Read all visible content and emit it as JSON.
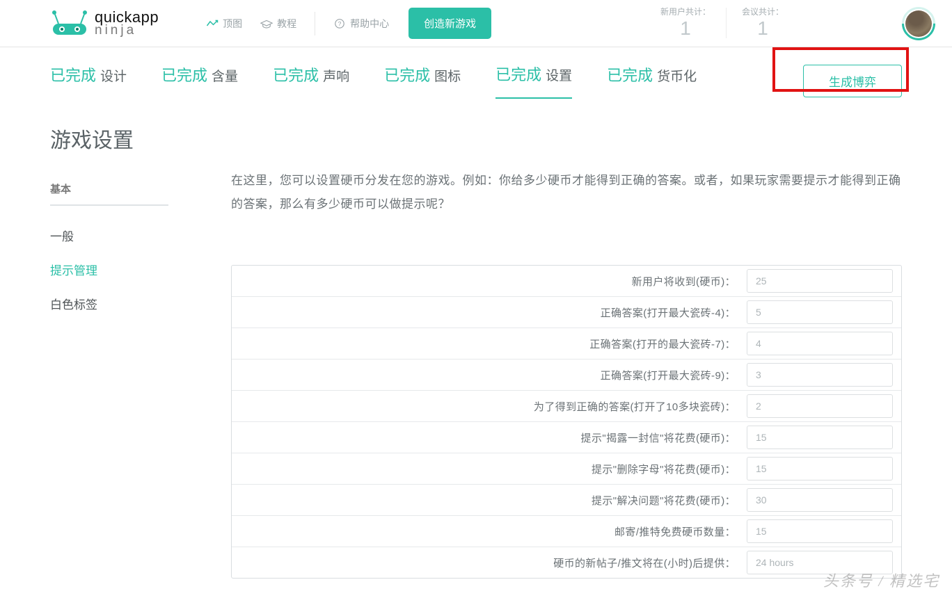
{
  "header": {
    "logo_line1": "quickapp",
    "logo_line2": "ninja",
    "nav": {
      "top": "顶图",
      "tutorial": "教程",
      "help": "帮助中心"
    },
    "create_button": "创造新游戏",
    "stats": {
      "new_users_label": "新用户共计：",
      "new_users_value": "1",
      "meetings_label": "会议共计：",
      "meetings_value": "1"
    }
  },
  "tabs": {
    "done_prefix": "已完成",
    "items": [
      "设计",
      "含量",
      "声响",
      "图标",
      "设置",
      "货币化"
    ],
    "active_index": 4,
    "generate": "生成博弈"
  },
  "page": {
    "title": "游戏设置"
  },
  "sidebar": {
    "heading": "基本",
    "items": [
      "一般",
      "提示管理",
      "白色标签"
    ],
    "active_index": 1
  },
  "description": "在这里，您可以设置硬币分发在您的游戏。例如：你给多少硬币才能得到正确的答案。或者，如果玩家需要提示才能得到正确的答案，那么有多少硬币可以做提示呢？",
  "settings": [
    {
      "label": "新用户将收到(硬币)：",
      "value": "25"
    },
    {
      "label": "正确答案(打开最大瓷砖-4)：",
      "value": "5"
    },
    {
      "label": "正确答案(打开的最大瓷砖-7)：",
      "value": "4"
    },
    {
      "label": "正确答案(打开最大瓷砖-9)：",
      "value": "3"
    },
    {
      "label": "为了得到正确的答案(打开了10多块瓷砖)：",
      "value": "2"
    },
    {
      "label": "提示\"揭露一封信\"将花费(硬币)：",
      "value": "15"
    },
    {
      "label": "提示\"删除字母\"将花费(硬币)：",
      "value": "15"
    },
    {
      "label": "提示\"解决问题\"将花费(硬币)：",
      "value": "30"
    },
    {
      "label": "邮寄/推特免费硬币数量：",
      "value": "15"
    },
    {
      "label": "硬币的新帖子/推文将在(小时)后提供：",
      "value": "24 hours"
    }
  ],
  "watermark": "头条号 / 精选宅"
}
